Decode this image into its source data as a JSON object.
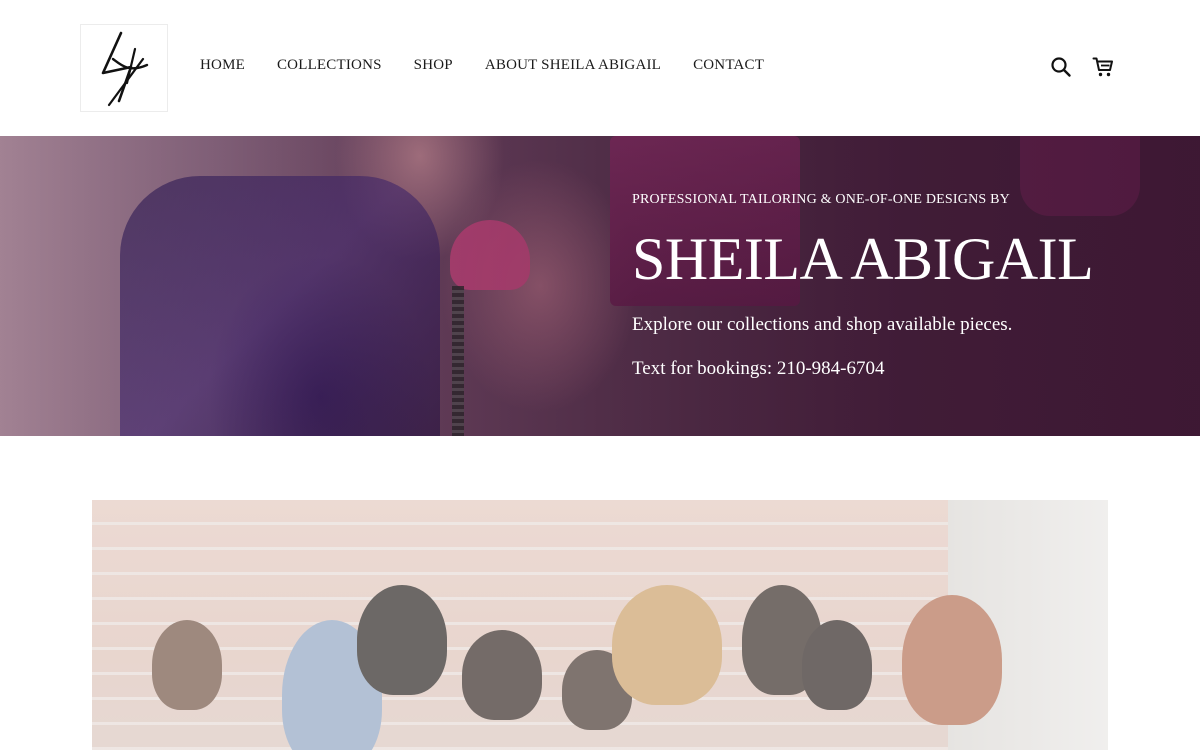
{
  "brand": {
    "logo_alt": "Sheila Abigail monogram logo"
  },
  "nav": {
    "items": [
      {
        "label": "HOME"
      },
      {
        "label": "COLLECTIONS"
      },
      {
        "label": "SHOP"
      },
      {
        "label": "ABOUT SHEILA ABIGAIL"
      },
      {
        "label": "CONTACT"
      }
    ]
  },
  "header_icons": {
    "search": "search-icon",
    "cart": "cart-icon"
  },
  "hero": {
    "eyebrow": "PROFESSIONAL TAILORING & ONE-OF-ONE DESIGNS BY",
    "title": "SHEILA ABIGAIL",
    "subtitle": "Explore our collections and shop available pieces.",
    "booking": "Text for bookings: 210-984-6704"
  },
  "colors": {
    "hero_overlay": "#45223b",
    "text_dark": "#1b1b1b",
    "text_light": "#ffffff"
  }
}
